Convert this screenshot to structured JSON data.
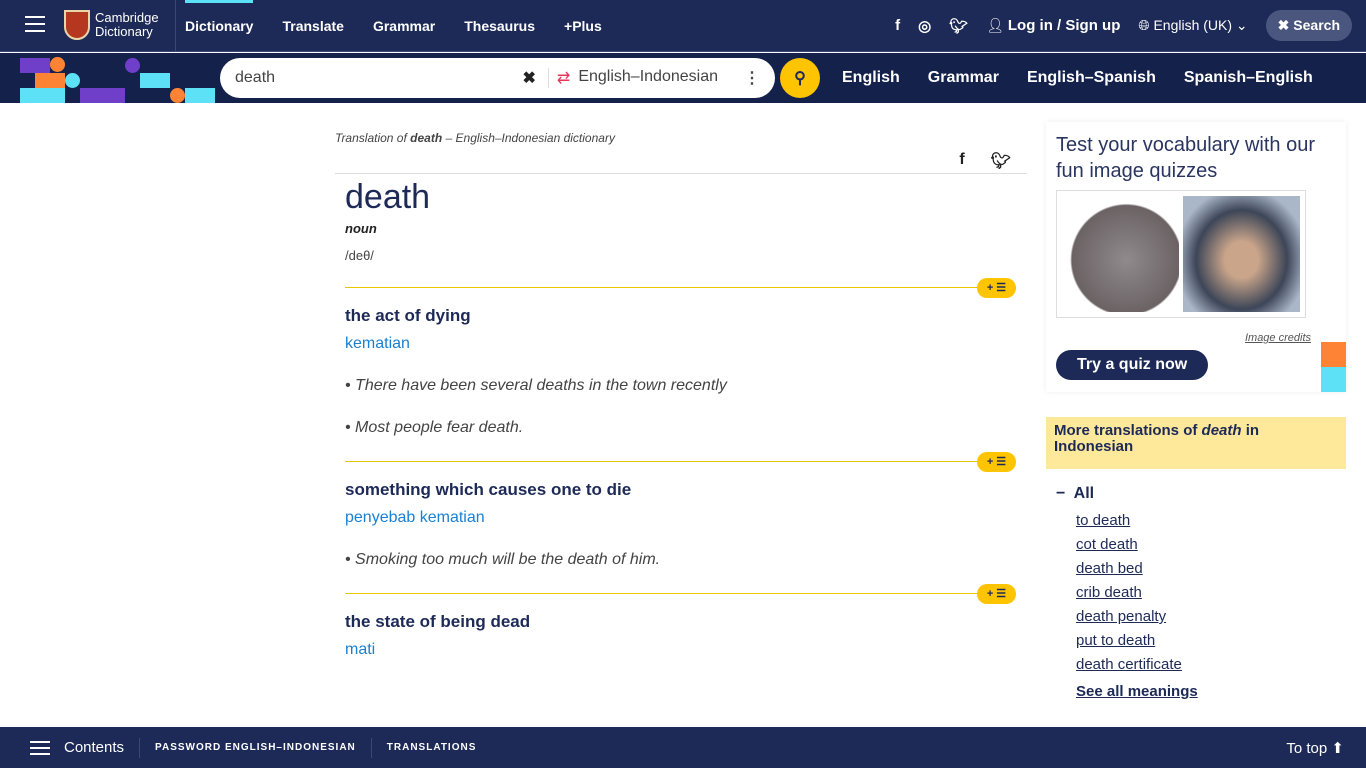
{
  "header": {
    "logo_line1": "Cambridge",
    "logo_line2": "Dictionary",
    "nav": [
      "Dictionary",
      "Translate",
      "Grammar",
      "Thesaurus",
      "+Plus"
    ],
    "login": "Log in / Sign up",
    "language": "English (UK)",
    "search_label": "Search"
  },
  "searchbar": {
    "query": "death",
    "dictionary": "English–Indonesian",
    "links": [
      "English",
      "Grammar",
      "English–Spanish",
      "Spanish–English"
    ]
  },
  "entry": {
    "crumb_pre": "Translation of ",
    "crumb_word": "death",
    "crumb_post": " – English–Indonesian dictionary",
    "headword": "death",
    "pos": "noun",
    "pron": "/deθ/",
    "senses": [
      {
        "guideword": "the act of dying",
        "translation": "kematian",
        "examples": [
          "There have been several deaths in the town recently",
          "Most people fear death."
        ]
      },
      {
        "guideword": "something which causes one to die",
        "translation": "penyebab kematian",
        "examples": [
          "Smoking too much will be the death of him."
        ]
      },
      {
        "guideword": "the state of being dead",
        "translation": "mati",
        "examples": []
      }
    ],
    "plus_label": "+ ☰"
  },
  "sidebar": {
    "quiz_title": "Test your vocabulary with our fun image quizzes",
    "image_credits": "Image credits",
    "quiz_button": "Try a quiz now",
    "more_pre": "More translations of ",
    "more_word": "death",
    "more_post": " in Indonesian",
    "all_label": "All",
    "meanings": [
      "to death",
      "cot death",
      "death bed",
      "crib death",
      "death penalty",
      "put to death",
      "death certificate"
    ],
    "see_all": "See all meanings"
  },
  "footer": {
    "contents": "Contents",
    "link1": "PASSWORD ENGLISH–INDONESIAN",
    "link2": "TRANSLATIONS",
    "to_top": "To top"
  },
  "colors": {
    "navy": "#1d2a57",
    "yellow": "#fec400",
    "link_blue": "#1a80d2"
  }
}
